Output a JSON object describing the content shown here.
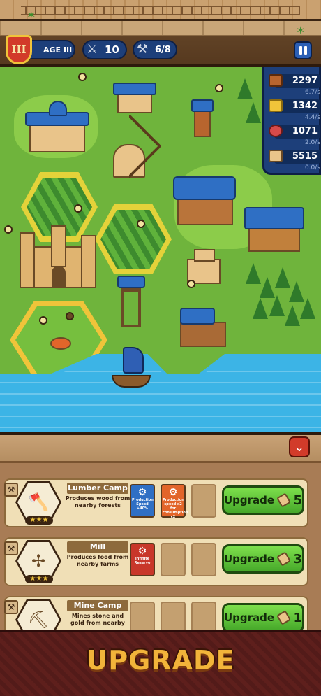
{
  "hud": {
    "age_numeral": "III",
    "age_label": "AGE III",
    "soldiers": "10",
    "builders": "6/8"
  },
  "resources": [
    {
      "icon": "wood-icon",
      "value": "2297",
      "rate": "6.7/s",
      "color": "#b8652e"
    },
    {
      "icon": "gold-icon",
      "value": "1342",
      "rate": "4.4/s",
      "color": "#f0c43a"
    },
    {
      "icon": "meat-icon",
      "value": "1071",
      "rate": "2.0/s",
      "color": "#d64a4a"
    },
    {
      "icon": "scroll-icon",
      "value": "5515",
      "rate": "0.0/s",
      "color": "#e9c48a"
    }
  ],
  "buildings": [
    {
      "name": "Lumber Camp",
      "description": "Produces wood from nearby forests",
      "boosts": [
        {
          "type": "blue",
          "label": "Production Speed +40%"
        },
        {
          "type": "orange",
          "label": "Production speed x2 for consumption c2"
        }
      ],
      "upgrade_label": "Upgrade",
      "cost": "5"
    },
    {
      "name": "Mill",
      "description": "Produces food from nearby farms",
      "boosts": [
        {
          "type": "red",
          "label": "Infinite Reserve"
        }
      ],
      "upgrade_label": "Upgrade",
      "cost": "3"
    },
    {
      "name": "Mine Camp",
      "description": "Mines stone and gold from nearby",
      "boosts": [],
      "upgrade_label": "Upgrade",
      "cost": "1"
    }
  ],
  "banner": {
    "title": "UPGRADE"
  }
}
